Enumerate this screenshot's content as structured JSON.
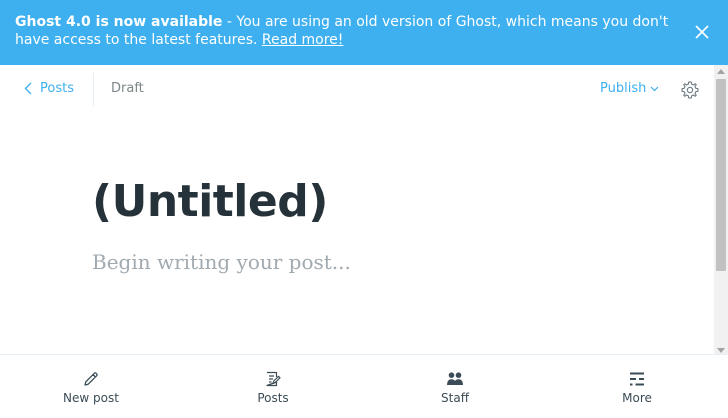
{
  "banner": {
    "title": "Ghost 4.0 is now available",
    "message": " - You are using an old version of Ghost, which means you don't have access to the latest features. ",
    "link": "Read more!"
  },
  "header": {
    "back_label": "Posts",
    "status": "Draft",
    "publish_label": "Publish"
  },
  "editor": {
    "title": "(Untitled)",
    "body_placeholder": "Begin writing your post..."
  },
  "nav": {
    "items": [
      {
        "label": "New post",
        "icon": "pencil-icon"
      },
      {
        "label": "Posts",
        "icon": "posts-icon"
      },
      {
        "label": "Staff",
        "icon": "staff-icon"
      },
      {
        "label": "More",
        "icon": "more-icon"
      }
    ]
  },
  "colors": {
    "banner_bg": "#3eb0ef",
    "accent": "#3eb0ef",
    "title_text": "#26323a",
    "placeholder_text": "#a0aab0"
  }
}
